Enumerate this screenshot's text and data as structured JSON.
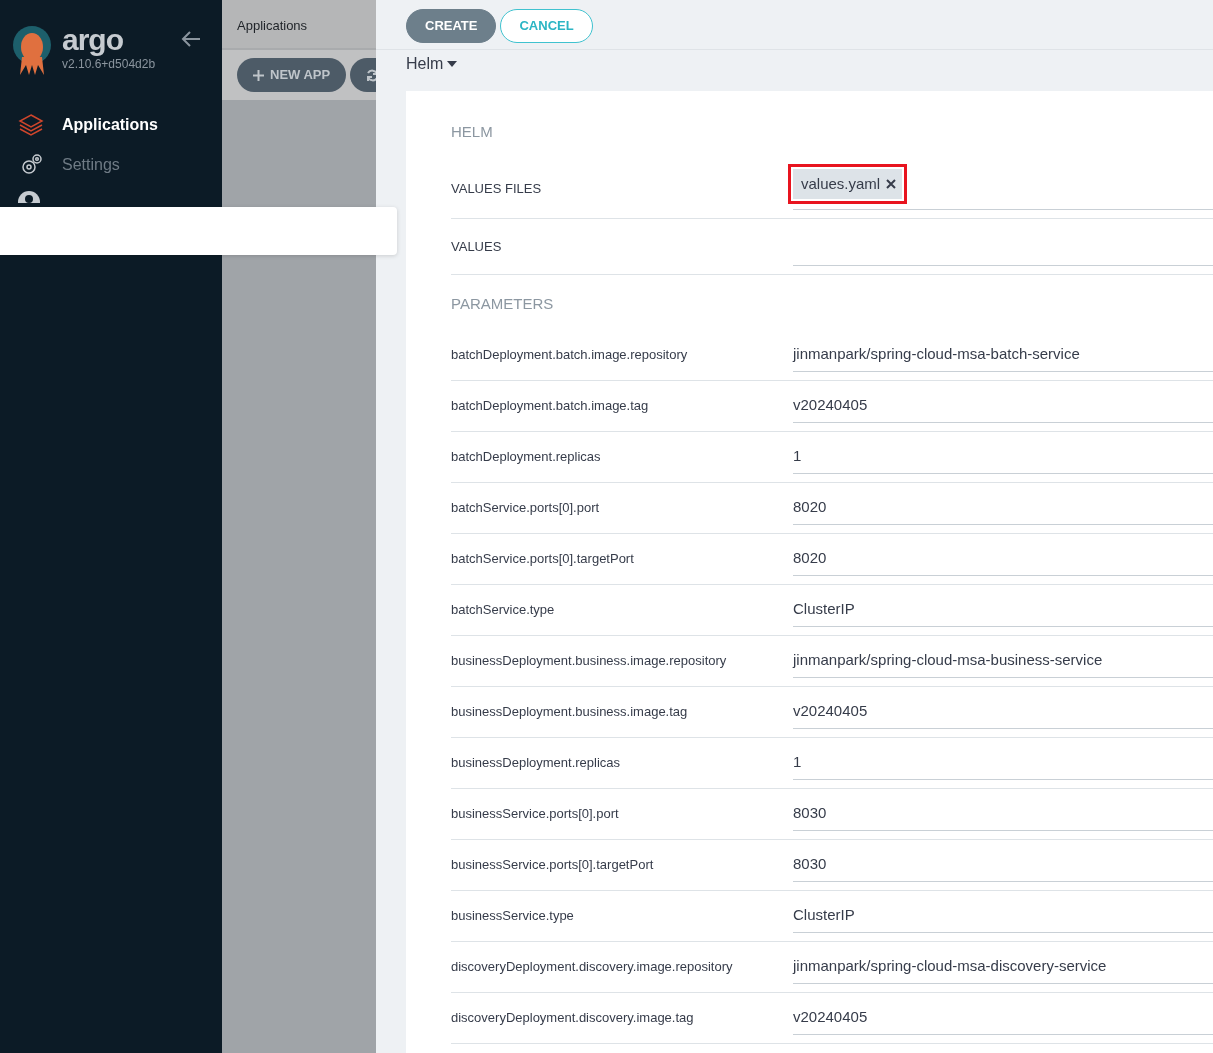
{
  "sidebar": {
    "logo_text": "argo",
    "version": "v2.10.6+d504d2b",
    "items": [
      {
        "label": "Applications",
        "kind": "apps",
        "selected": true
      },
      {
        "label": "Settings",
        "kind": "settings",
        "selected": false
      },
      {
        "kind": "user",
        "selected": false
      }
    ]
  },
  "background_page": {
    "title": "Applications",
    "buttons": [
      {
        "kind": "new",
        "label": "NEW APP"
      },
      {
        "kind": "sync"
      }
    ]
  },
  "panel": {
    "buttons": [
      {
        "kind": "primary",
        "label": "CREATE"
      },
      {
        "kind": "outline",
        "label": "CANCEL"
      }
    ],
    "source_type": "Helm",
    "section": "HELM",
    "values_files": {
      "label": "VALUES FILES",
      "files": [
        {
          "name": "values.yaml",
          "highlighted": true
        }
      ]
    },
    "values": {
      "label": "VALUES"
    },
    "parameters_title": "PARAMETERS",
    "parameters": [
      {
        "name": "batchDeployment.batch.image.repository",
        "value": "jinmanpark/spring-cloud-msa-batch-service"
      },
      {
        "name": "batchDeployment.batch.image.tag",
        "value": "v20240405"
      },
      {
        "name": "batchDeployment.replicas",
        "value": "1"
      },
      {
        "name": "batchService.ports[0].port",
        "value": "8020"
      },
      {
        "name": "batchService.ports[0].targetPort",
        "value": "8020"
      },
      {
        "name": "batchService.type",
        "value": "ClusterIP"
      },
      {
        "name": "businessDeployment.business.image.repository",
        "value": "jinmanpark/spring-cloud-msa-business-service"
      },
      {
        "name": "businessDeployment.business.image.tag",
        "value": "v20240405"
      },
      {
        "name": "businessDeployment.replicas",
        "value": "1"
      },
      {
        "name": "businessService.ports[0].port",
        "value": "8030"
      },
      {
        "name": "businessService.ports[0].targetPort",
        "value": "8030"
      },
      {
        "name": "businessService.type",
        "value": "ClusterIP"
      },
      {
        "name": "discoveryDeployment.discovery.image.repository",
        "value": "jinmanpark/spring-cloud-msa-discovery-service"
      },
      {
        "name": "discoveryDeployment.discovery.image.tag",
        "value": "v20240405"
      }
    ]
  }
}
